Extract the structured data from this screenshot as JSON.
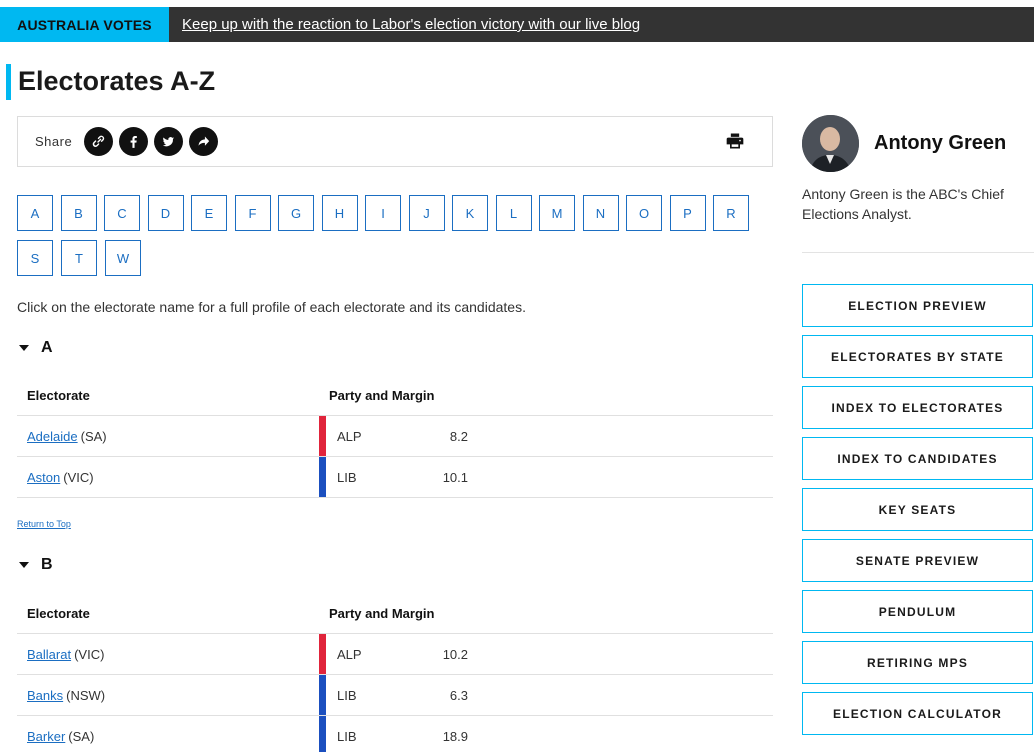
{
  "banner": {
    "tag": "AUSTRALIA VOTES",
    "link": "Keep up with the reaction to Labor's election victory with our live blog"
  },
  "page": {
    "title": "Electorates A-Z",
    "intro": "Click on the electorate name for a full profile of each electorate and its candidates.",
    "return_top": "Return to Top"
  },
  "share": {
    "label": "Share",
    "icons": [
      "link-icon",
      "facebook-icon",
      "twitter-icon",
      "share-arrow-icon",
      "print-icon"
    ]
  },
  "letters": [
    "A",
    "B",
    "C",
    "D",
    "E",
    "F",
    "G",
    "H",
    "I",
    "J",
    "K",
    "L",
    "M",
    "N",
    "O",
    "P",
    "R",
    "S",
    "T",
    "W"
  ],
  "table_headers": {
    "electorate": "Electorate",
    "party": "Party and Margin"
  },
  "sections": [
    {
      "letter": "A",
      "rows": [
        {
          "name": "Adelaide",
          "state": "(SA)",
          "party": "ALP",
          "margin": "8.2"
        },
        {
          "name": "Aston",
          "state": "(VIC)",
          "party": "LIB",
          "margin": "10.1"
        }
      ]
    },
    {
      "letter": "B",
      "rows": [
        {
          "name": "Ballarat",
          "state": "(VIC)",
          "party": "ALP",
          "margin": "10.2"
        },
        {
          "name": "Banks",
          "state": "(NSW)",
          "party": "LIB",
          "margin": "6.3"
        },
        {
          "name": "Barker",
          "state": "(SA)",
          "party": "LIB",
          "margin": "18.9"
        }
      ]
    }
  ],
  "party_colors": {
    "ALP": "#E0243B",
    "LIB": "#1B4FBF"
  },
  "author": {
    "name": "Antony Green",
    "bio": "Antony Green is the ABC's Chief Elections Analyst."
  },
  "side_nav": [
    "ELECTION PREVIEW",
    "ELECTORATES BY STATE",
    "INDEX TO ELECTORATES",
    "INDEX TO CANDIDATES",
    "KEY SEATS",
    "SENATE PREVIEW",
    "PENDULUM",
    "RETIRING MPS",
    "ELECTION CALCULATOR"
  ],
  "colors": {
    "accent": "#00B8F1",
    "link": "#1b6ec2",
    "banner_bg": "#333333"
  }
}
